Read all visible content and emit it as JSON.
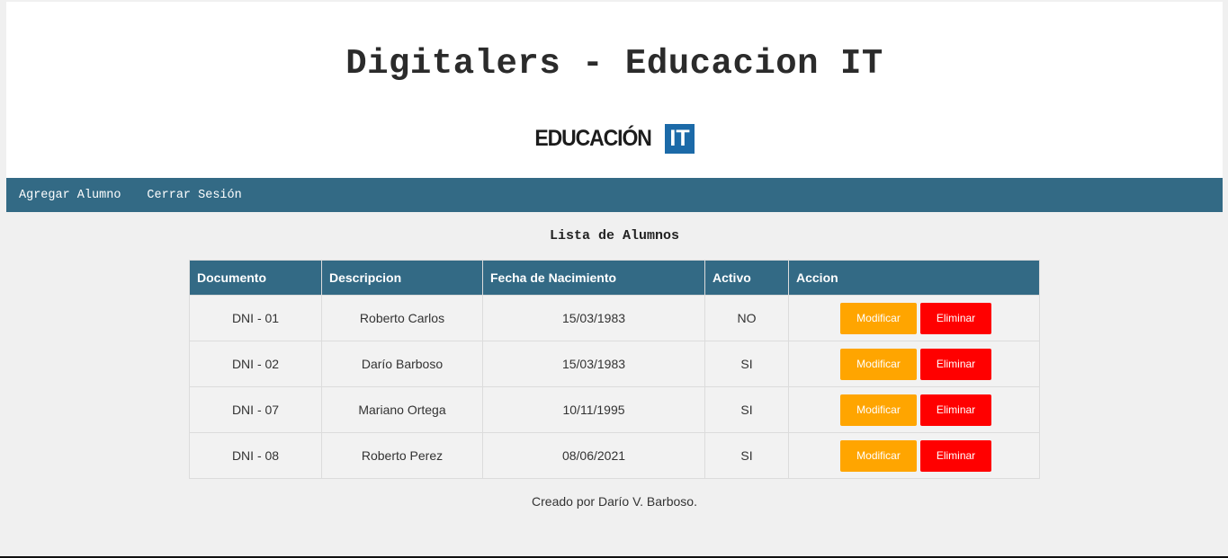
{
  "header": {
    "title": "Digitalers - Educacion IT",
    "logo_text": "EDUCACIÓN",
    "logo_box_text": "IT"
  },
  "nav": {
    "items": [
      {
        "label": "Agregar Alumno"
      },
      {
        "label": "Cerrar Sesión"
      }
    ]
  },
  "main": {
    "title": "Lista de Alumnos",
    "table": {
      "headers": [
        "Documento",
        "Descripcion",
        "Fecha de Nacimiento",
        "Activo",
        "Accion"
      ],
      "rows": [
        {
          "documento": "DNI - 01",
          "descripcion": "Roberto Carlos",
          "fecha": "15/03/1983",
          "activo": "NO",
          "modificar": "Modificar",
          "eliminar": "Eliminar"
        },
        {
          "documento": "DNI - 02",
          "descripcion": "Darío Barboso",
          "fecha": "15/03/1983",
          "activo": "SI",
          "modificar": "Modificar",
          "eliminar": "Eliminar"
        },
        {
          "documento": "DNI - 07",
          "descripcion": "Mariano Ortega",
          "fecha": "10/11/1995",
          "activo": "SI",
          "modificar": "Modificar",
          "eliminar": "Eliminar"
        },
        {
          "documento": "DNI - 08",
          "descripcion": "Roberto Perez",
          "fecha": "08/06/2021",
          "activo": "SI",
          "modificar": "Modificar",
          "eliminar": "Eliminar"
        }
      ]
    }
  },
  "footer": {
    "text": "Creado por Darío V. Barboso."
  },
  "colors": {
    "nav_bg": "#336a85",
    "modify_button": "#ffa500",
    "delete_button": "#ff0000",
    "logo_accent": "#1c6aa8"
  }
}
